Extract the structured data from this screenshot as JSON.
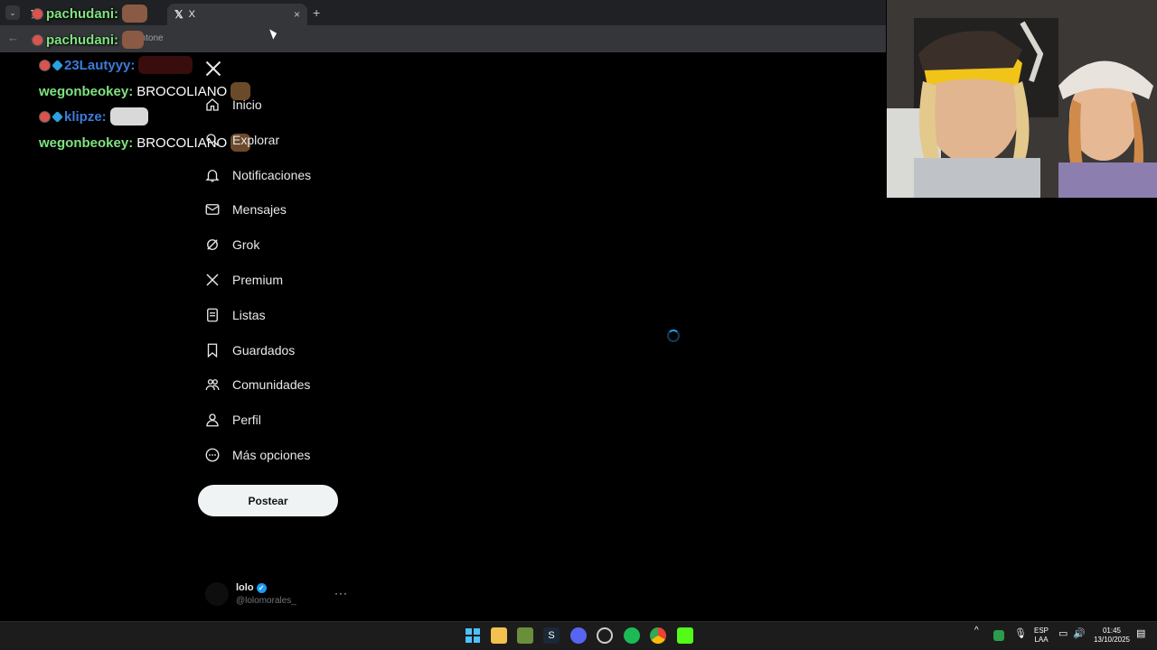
{
  "browser": {
    "tabs": [
      {
        "title": "",
        "active": false
      },
      {
        "title": "X",
        "active": true
      }
    ],
    "new_tab": "+",
    "tab_close": "×",
    "address_text": "antone"
  },
  "chat": [
    {
      "user": "pachudani:",
      "color": "#7fe37f",
      "text": ""
    },
    {
      "user": "pachudani:",
      "color": "#7fe37f",
      "text": ""
    },
    {
      "user": "23Lautyyy:",
      "color": "#3c7bd9",
      "text": ""
    },
    {
      "user": "wegonbeokey:",
      "color": "#7fe37f",
      "text": "BROCOLIANO"
    },
    {
      "user": "klipze:",
      "color": "#3c7bd9",
      "text": ""
    },
    {
      "user": "wegonbeokey:",
      "color": "#7fe37f",
      "text": "BROCOLIANO"
    }
  ],
  "nav": {
    "logo": "X",
    "items": [
      {
        "label": "Inicio",
        "icon": "home-icon"
      },
      {
        "label": "Explorar",
        "icon": "search-icon"
      },
      {
        "label": "Notificaciones",
        "icon": "bell-icon"
      },
      {
        "label": "Mensajes",
        "icon": "envelope-icon"
      },
      {
        "label": "Grok",
        "icon": "grok-icon"
      },
      {
        "label": "Premium",
        "icon": "x-icon"
      },
      {
        "label": "Listas",
        "icon": "list-icon"
      },
      {
        "label": "Guardados",
        "icon": "bookmark-icon"
      },
      {
        "label": "Comunidades",
        "icon": "people-icon"
      },
      {
        "label": "Perfil",
        "icon": "person-icon"
      },
      {
        "label": "Más opciones",
        "icon": "more-circle-icon"
      }
    ],
    "post_button": "Postear"
  },
  "account": {
    "name": "lolo",
    "handle": "@lolomorales_",
    "more": "···"
  },
  "taskbar": {
    "lang_top": "ESP",
    "lang_bottom": "LAA",
    "time": "01:45",
    "date": "13/10/2025"
  }
}
